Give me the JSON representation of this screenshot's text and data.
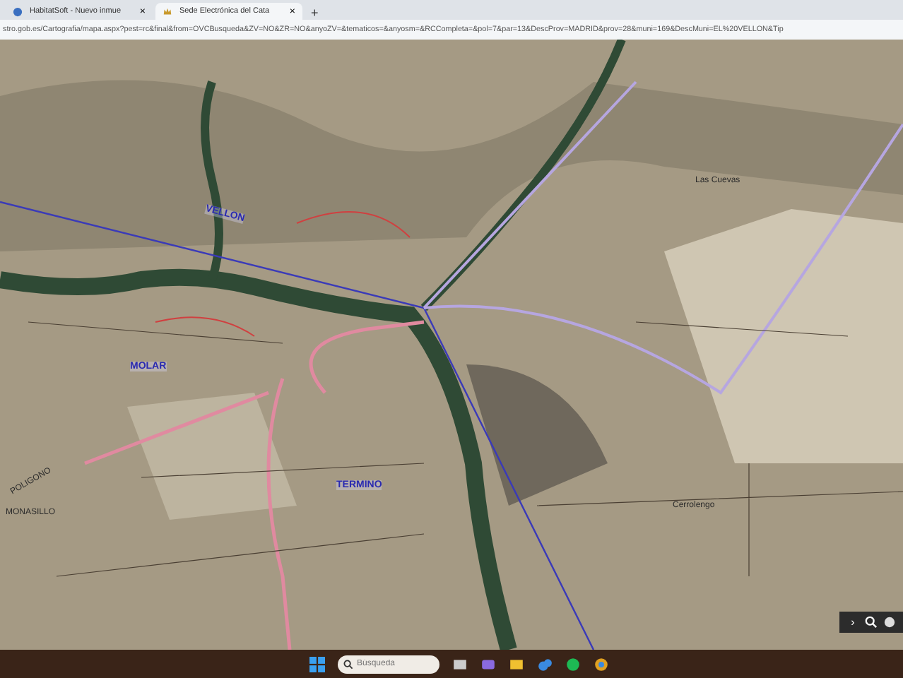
{
  "browser": {
    "tabs": [
      {
        "title": "HabitatSoft - Nuevo inmue",
        "close": "×",
        "selected": false
      },
      {
        "title": "Sede Electrónica del Cata",
        "close": "×",
        "selected": true
      }
    ],
    "new_tab": "+",
    "url": "stro.gob.es/Cartografia/mapa.aspx?pest=rc&final&from=OVCBusqueda&ZV=NO&ZR=NO&anyoZV=&tematicos=&anyosm=&RCCompleta=&pol=7&par=13&DescProv=MADRID&prov=28&muni=169&DescMuni=EL%20VELLON&Tip"
  },
  "map": {
    "labels": [
      {
        "text": "VELLON",
        "kind": "place"
      },
      {
        "text": "MOLAR",
        "kind": "place"
      },
      {
        "text": "TERMINO",
        "kind": "place"
      },
      {
        "text": "POLIGONO",
        "kind": "area"
      },
      {
        "text": "MONASILLO",
        "kind": "area"
      },
      {
        "text": "Las Cuevas",
        "kind": "area"
      },
      {
        "text": "Cerrolengo",
        "kind": "area"
      }
    ],
    "controls": {
      "expand": "›"
    }
  },
  "taskbar": {
    "search": {
      "placeholder": "Búsqueda"
    }
  }
}
